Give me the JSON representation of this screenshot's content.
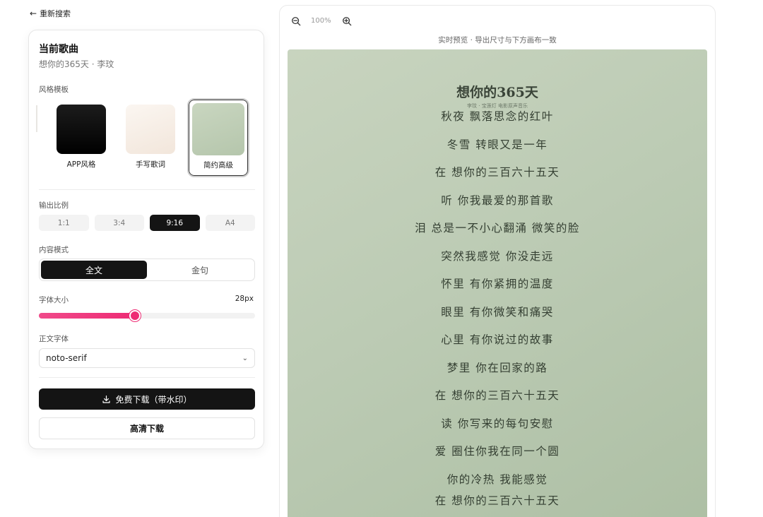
{
  "back": {
    "label": "重新搜索"
  },
  "panel": {
    "current_song_label": "当前歌曲",
    "song_subtitle": "想你的365天 · 李玟",
    "style_label": "风格模板",
    "templates": [
      {
        "name": "APP风格",
        "color": "#0a0a0a"
      },
      {
        "name": "手写歌词",
        "color": "#f6ece4"
      },
      {
        "name": "简约高级",
        "color": "#c1ceb8",
        "selected": true
      }
    ],
    "ratio_label": "输出比例",
    "ratios": [
      "1:1",
      "3:4",
      "9:16",
      "A4"
    ],
    "ratio_selected": "9:16",
    "mode_label": "内容模式",
    "modes": [
      "全文",
      "金句"
    ],
    "mode_selected": "全文",
    "font_size_label": "字体大小",
    "font_size_value": "28px",
    "font_size_fraction": 0.445,
    "font_label": "正文字体",
    "font_value": "noto-serif",
    "download_label": "免费下载（带水印）",
    "hd_label": "高清下载"
  },
  "preview": {
    "zoom": "100%",
    "hint": "实时预览 · 导出尺寸与下方画布一致",
    "card_title": "想你的365天",
    "card_subtitle": "李玟 · 宝莲灯 电影原声音乐",
    "lyrics": [
      "秋夜 飘落思念的红叶",
      "冬雪 转眼又是一年",
      "在 想你的三百六十五天",
      "听 你我最爱的那首歌",
      "泪 总是一不小心翻涌 微笑的脸",
      "突然我感觉 你没走远",
      "怀里 有你紧拥的温度",
      "眼里 有你微笑和痛哭",
      "心里 有你说过的故事",
      "梦里 你在回家的路",
      "在 想你的三百六十五天",
      "读 你写来的每句安慰",
      "爱 圈住你我在同一个圆",
      "你的冷热 我能感觉",
      "在 想你的三百六十五天"
    ]
  }
}
